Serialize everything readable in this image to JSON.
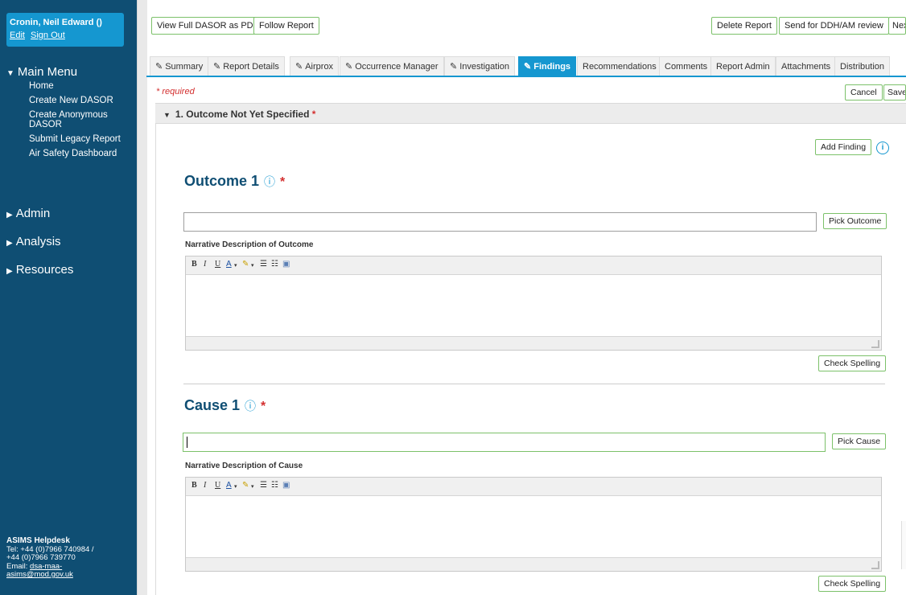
{
  "user": {
    "name": "Cronin, Neil Edward ()",
    "edit": "Edit",
    "sign_out": "Sign Out"
  },
  "nav": {
    "main_menu": "Main Menu",
    "items": [
      "Home",
      "Create New DASOR",
      "Create Anonymous DASOR",
      "Submit Legacy Report",
      "Air Safety Dashboard"
    ],
    "admin": "Admin",
    "analysis": "Analysis",
    "resources": "Resources"
  },
  "helpdesk": {
    "title": "ASIMS Helpdesk",
    "tel1": "Tel: +44 (0)7966 740984 /",
    "tel2": "+44 (0)7966 739770",
    "email_label": "Email: ",
    "email1": "dsa-maa-",
    "email2": "asims@mod.gov.uk"
  },
  "toolbar": {
    "view_pdf": "View Full DASOR as PDF",
    "follow": "Follow Report",
    "delete": "Delete Report",
    "send_review": "Send for DDH/AM review",
    "next": "Next"
  },
  "tabs": [
    {
      "label": "Summary",
      "edit_icon": true
    },
    {
      "label": "Report Details",
      "edit_icon": true
    },
    {
      "label": "Airprox",
      "edit_icon": true
    },
    {
      "label": "Occurrence Manager",
      "edit_icon": true
    },
    {
      "label": "Investigation",
      "edit_icon": true
    },
    {
      "label": "Findings",
      "edit_icon": true,
      "active": true
    },
    {
      "label": "Recommendations"
    },
    {
      "label": "Comments"
    },
    {
      "label": "Report Admin"
    },
    {
      "label": "Attachments"
    },
    {
      "label": "Distribution"
    }
  ],
  "form": {
    "required_note": "* required",
    "cancel": "Cancel",
    "save": "Save",
    "section_title": "1. Outcome Not Yet Specified",
    "add_finding": "Add Finding",
    "outcome": {
      "heading": "Outcome 1",
      "value": "",
      "pick": "Pick Outcome",
      "narrative_label": "Narrative Description of Outcome",
      "check_spelling": "Check Spelling"
    },
    "cause": {
      "heading": "Cause 1",
      "value": "",
      "pick": "Pick Cause",
      "narrative_label": "Narrative Description of Cause",
      "check_spelling": "Check Spelling"
    }
  },
  "editor_toolbar": [
    "B",
    "I",
    "U",
    "A",
    "▾",
    "✎",
    "▾",
    "☰",
    "☷",
    "▣"
  ],
  "colors": {
    "sidebar": "#0f4e73",
    "accent": "#1597d0",
    "button_border": "#7cc16a",
    "required": "#d32f2f"
  }
}
